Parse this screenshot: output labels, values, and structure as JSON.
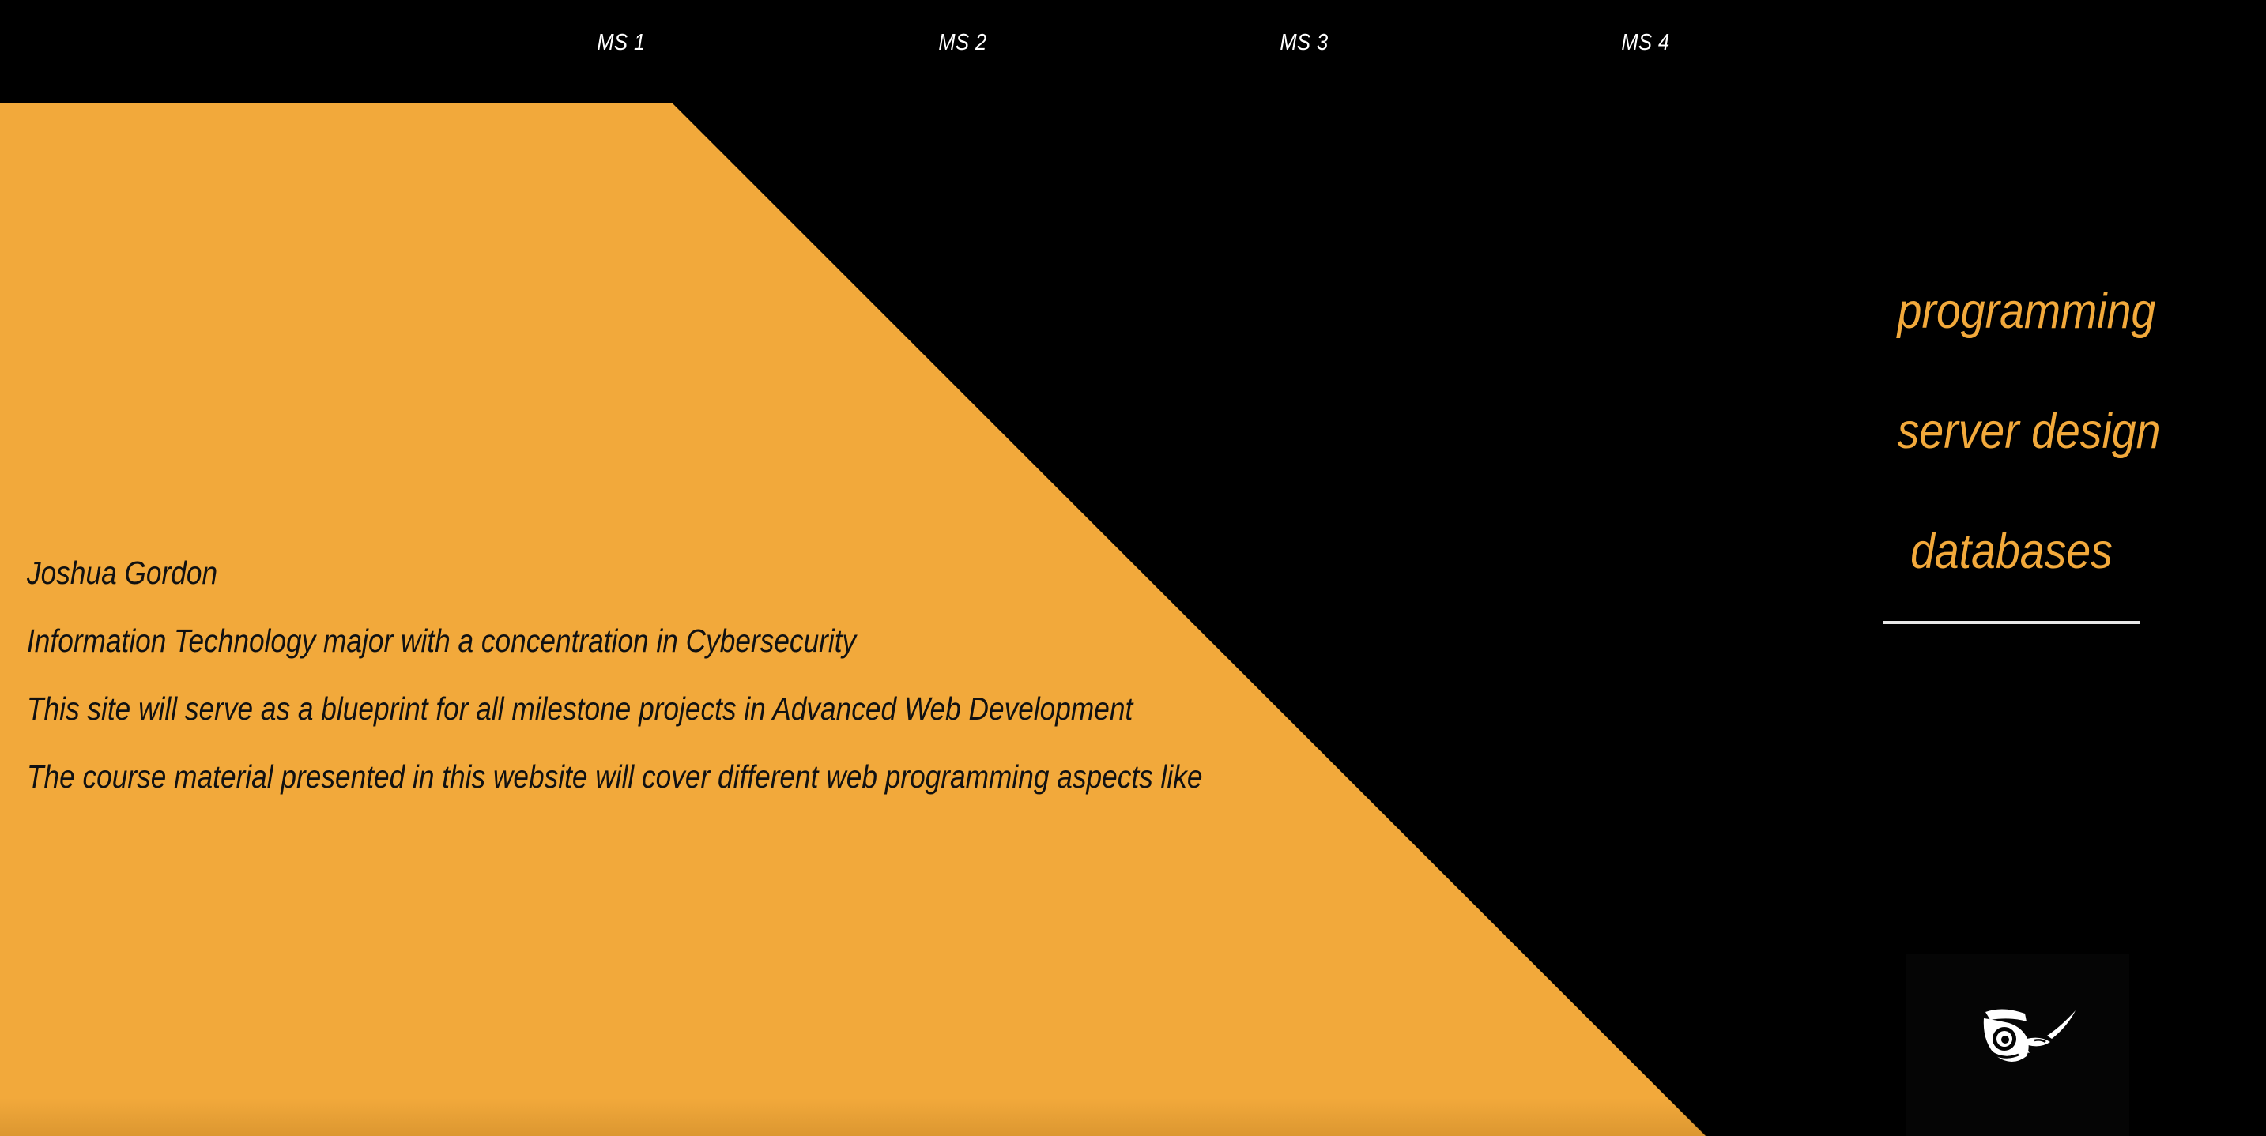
{
  "nav": {
    "items": [
      {
        "label": "MS 1"
      },
      {
        "label": "MS 2"
      },
      {
        "label": "MS 3"
      },
      {
        "label": "MS 4"
      }
    ]
  },
  "intro": {
    "name": "Joshua Gordon",
    "line1": "Information Technology major with a concentration in Cybersecurity",
    "line2": "This site will serve as a blueprint for all milestone projects in Advanced Web Development",
    "line3": "The course material presented in this website will cover different web programming aspects like"
  },
  "topics": {
    "items": [
      {
        "label": "programming"
      },
      {
        "label": "server design"
      },
      {
        "label": "databases"
      }
    ]
  },
  "logo": {
    "icon": "owl-icon"
  },
  "colors": {
    "background": "#000000",
    "accent": "#f2a93b",
    "nav_text": "#ffffff",
    "body_text": "#111111",
    "underline": "#e8e8e8"
  }
}
